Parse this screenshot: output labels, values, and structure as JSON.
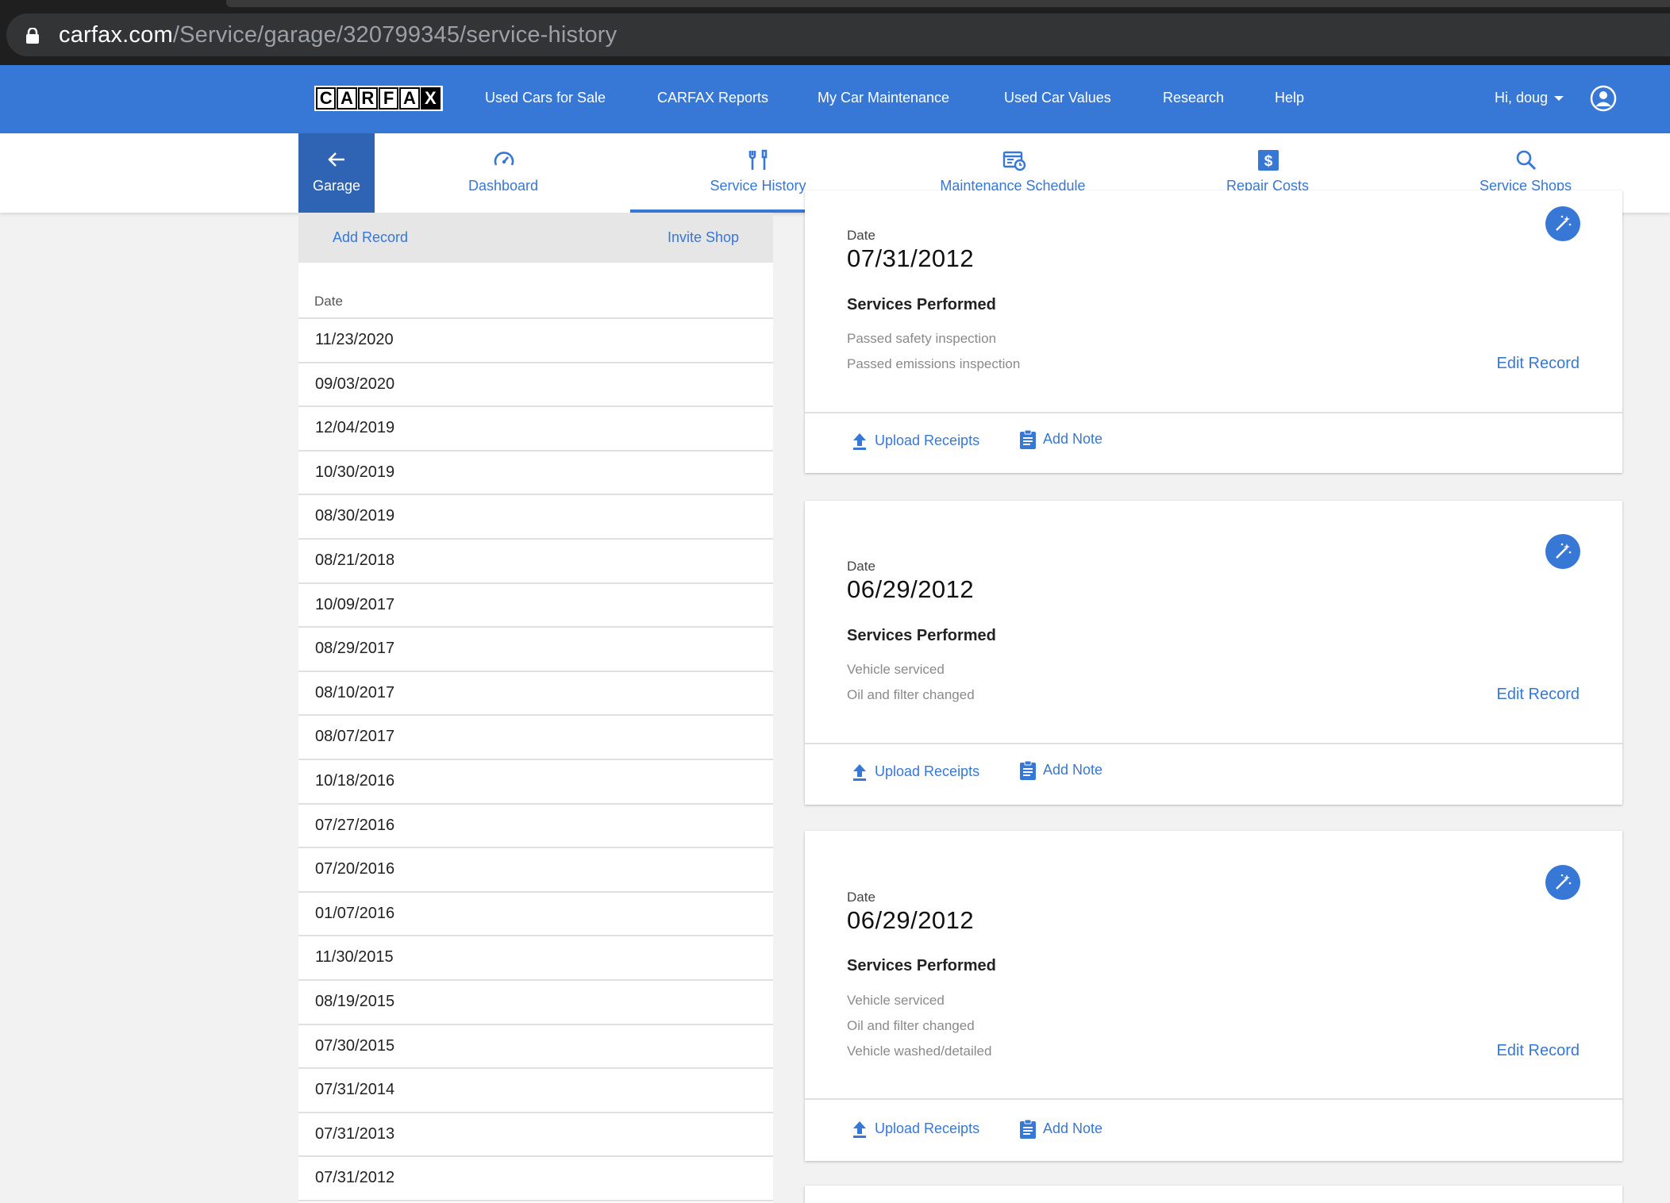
{
  "browser": {
    "url_host": "carfax.com",
    "url_path": "/Service/garage/320799345/service-history"
  },
  "logo": {
    "letters": [
      "C",
      "A",
      "R",
      "F",
      "A",
      "X"
    ]
  },
  "topnav": {
    "links": [
      "Used Cars for Sale",
      "CARFAX Reports",
      "My Car Maintenance",
      "Used Car Values",
      "Research",
      "Help"
    ],
    "user_greeting": "Hi, doug"
  },
  "subnav": {
    "back_label": "Garage",
    "tabs": [
      {
        "label": "Dashboard",
        "icon": "speedometer-icon"
      },
      {
        "label": "Service History",
        "icon": "tools-icon",
        "active": true
      },
      {
        "label": "Maintenance Schedule",
        "icon": "calendar-clock-icon"
      },
      {
        "label": "Repair Costs",
        "icon": "dollar-icon"
      },
      {
        "label": "Service Shops",
        "icon": "search-icon"
      }
    ]
  },
  "left_panel": {
    "add_record": "Add Record",
    "invite_shop": "Invite Shop",
    "column_header": "Date",
    "dates": [
      "11/23/2020",
      "09/03/2020",
      "12/04/2019",
      "10/30/2019",
      "08/30/2019",
      "08/21/2018",
      "10/09/2017",
      "08/29/2017",
      "08/10/2017",
      "08/07/2017",
      "10/18/2016",
      "07/27/2016",
      "07/20/2016",
      "01/07/2016",
      "11/30/2015",
      "08/19/2015",
      "07/30/2015",
      "07/31/2014",
      "07/31/2013",
      "07/31/2012"
    ]
  },
  "cards": [
    {
      "date_label": "Date",
      "date": "07/31/2012",
      "services_title": "Services Performed",
      "services": [
        "Passed safety inspection",
        "Passed emissions inspection"
      ],
      "edit_label": "Edit Record",
      "upload_label": "Upload Receipts",
      "note_label": "Add Note"
    },
    {
      "date_label": "Date",
      "date": "06/29/2012",
      "services_title": "Services Performed",
      "services": [
        "Vehicle serviced",
        "Oil and filter changed"
      ],
      "edit_label": "Edit Record",
      "upload_label": "Upload Receipts",
      "note_label": "Add Note"
    },
    {
      "date_label": "Date",
      "date": "06/29/2012",
      "services_title": "Services Performed",
      "services": [
        "Vehicle serviced",
        "Oil and filter changed",
        "Vehicle washed/detailed"
      ],
      "edit_label": "Edit Record",
      "upload_label": "Upload Receipts",
      "note_label": "Add Note"
    }
  ],
  "colors": {
    "brand_blue": "#3777d6",
    "garage_blue": "#2f64b5"
  }
}
